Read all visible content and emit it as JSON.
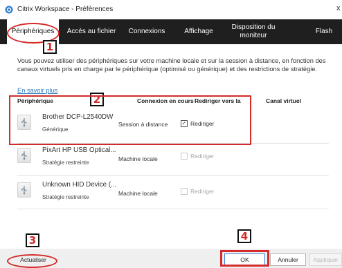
{
  "window": {
    "title": "Citrix Workspace - Préférences",
    "close_glyph": "x",
    "app_icon": "citrix-icon"
  },
  "tabs": [
    {
      "label": "Périphériques",
      "active": true
    },
    {
      "label": "Accès au fichier",
      "active": false
    },
    {
      "label": "Connexions",
      "active": false
    },
    {
      "label": "Affichage",
      "active": false
    },
    {
      "label": "Disposition du moniteur",
      "active": false
    },
    {
      "label": "Flash",
      "active": false
    }
  ],
  "callouts": [
    "1",
    "2",
    "3",
    "4"
  ],
  "description": "Vous pouvez utiliser des périphériques sur votre machine locale et sur la session à distance, en fonction des canaux virtuels pris en charge par le périphérique (optimisé ou générique) et des restrictions de stratégie.",
  "learn_more": "En savoir plus",
  "table": {
    "headers": {
      "device": "Périphérique",
      "connection": "Connexion en cours",
      "redirect": "Rediriger vers la",
      "channel": "Canal virtuel"
    },
    "rows": [
      {
        "name": "Brother DCP-L2540DW",
        "policy": "Générique",
        "connection": "Session à distance",
        "redirect_label": "Rediriger",
        "checked": true,
        "enabled": true,
        "icon": "usb-icon"
      },
      {
        "name": "PixArt HP USB Optical...",
        "policy": "Stratégie restreinte",
        "connection": "Machine locale",
        "redirect_label": "Rediriger",
        "checked": false,
        "enabled": false,
        "icon": "usb-icon"
      },
      {
        "name": "Unknown HID Device (...",
        "policy": "Stratégie restreinte",
        "connection": "Machine locale",
        "redirect_label": "Rediriger",
        "checked": false,
        "enabled": false,
        "icon": "usb-icon"
      }
    ]
  },
  "footer": {
    "refresh": "Actualiser",
    "ok": "OK",
    "cancel": "Annuler",
    "apply": "Appliquer"
  },
  "colors": {
    "tabbar_bg": "#1f1f1f",
    "annotation_red": "#d42a2a",
    "link_blue": "#2a7bbf"
  }
}
